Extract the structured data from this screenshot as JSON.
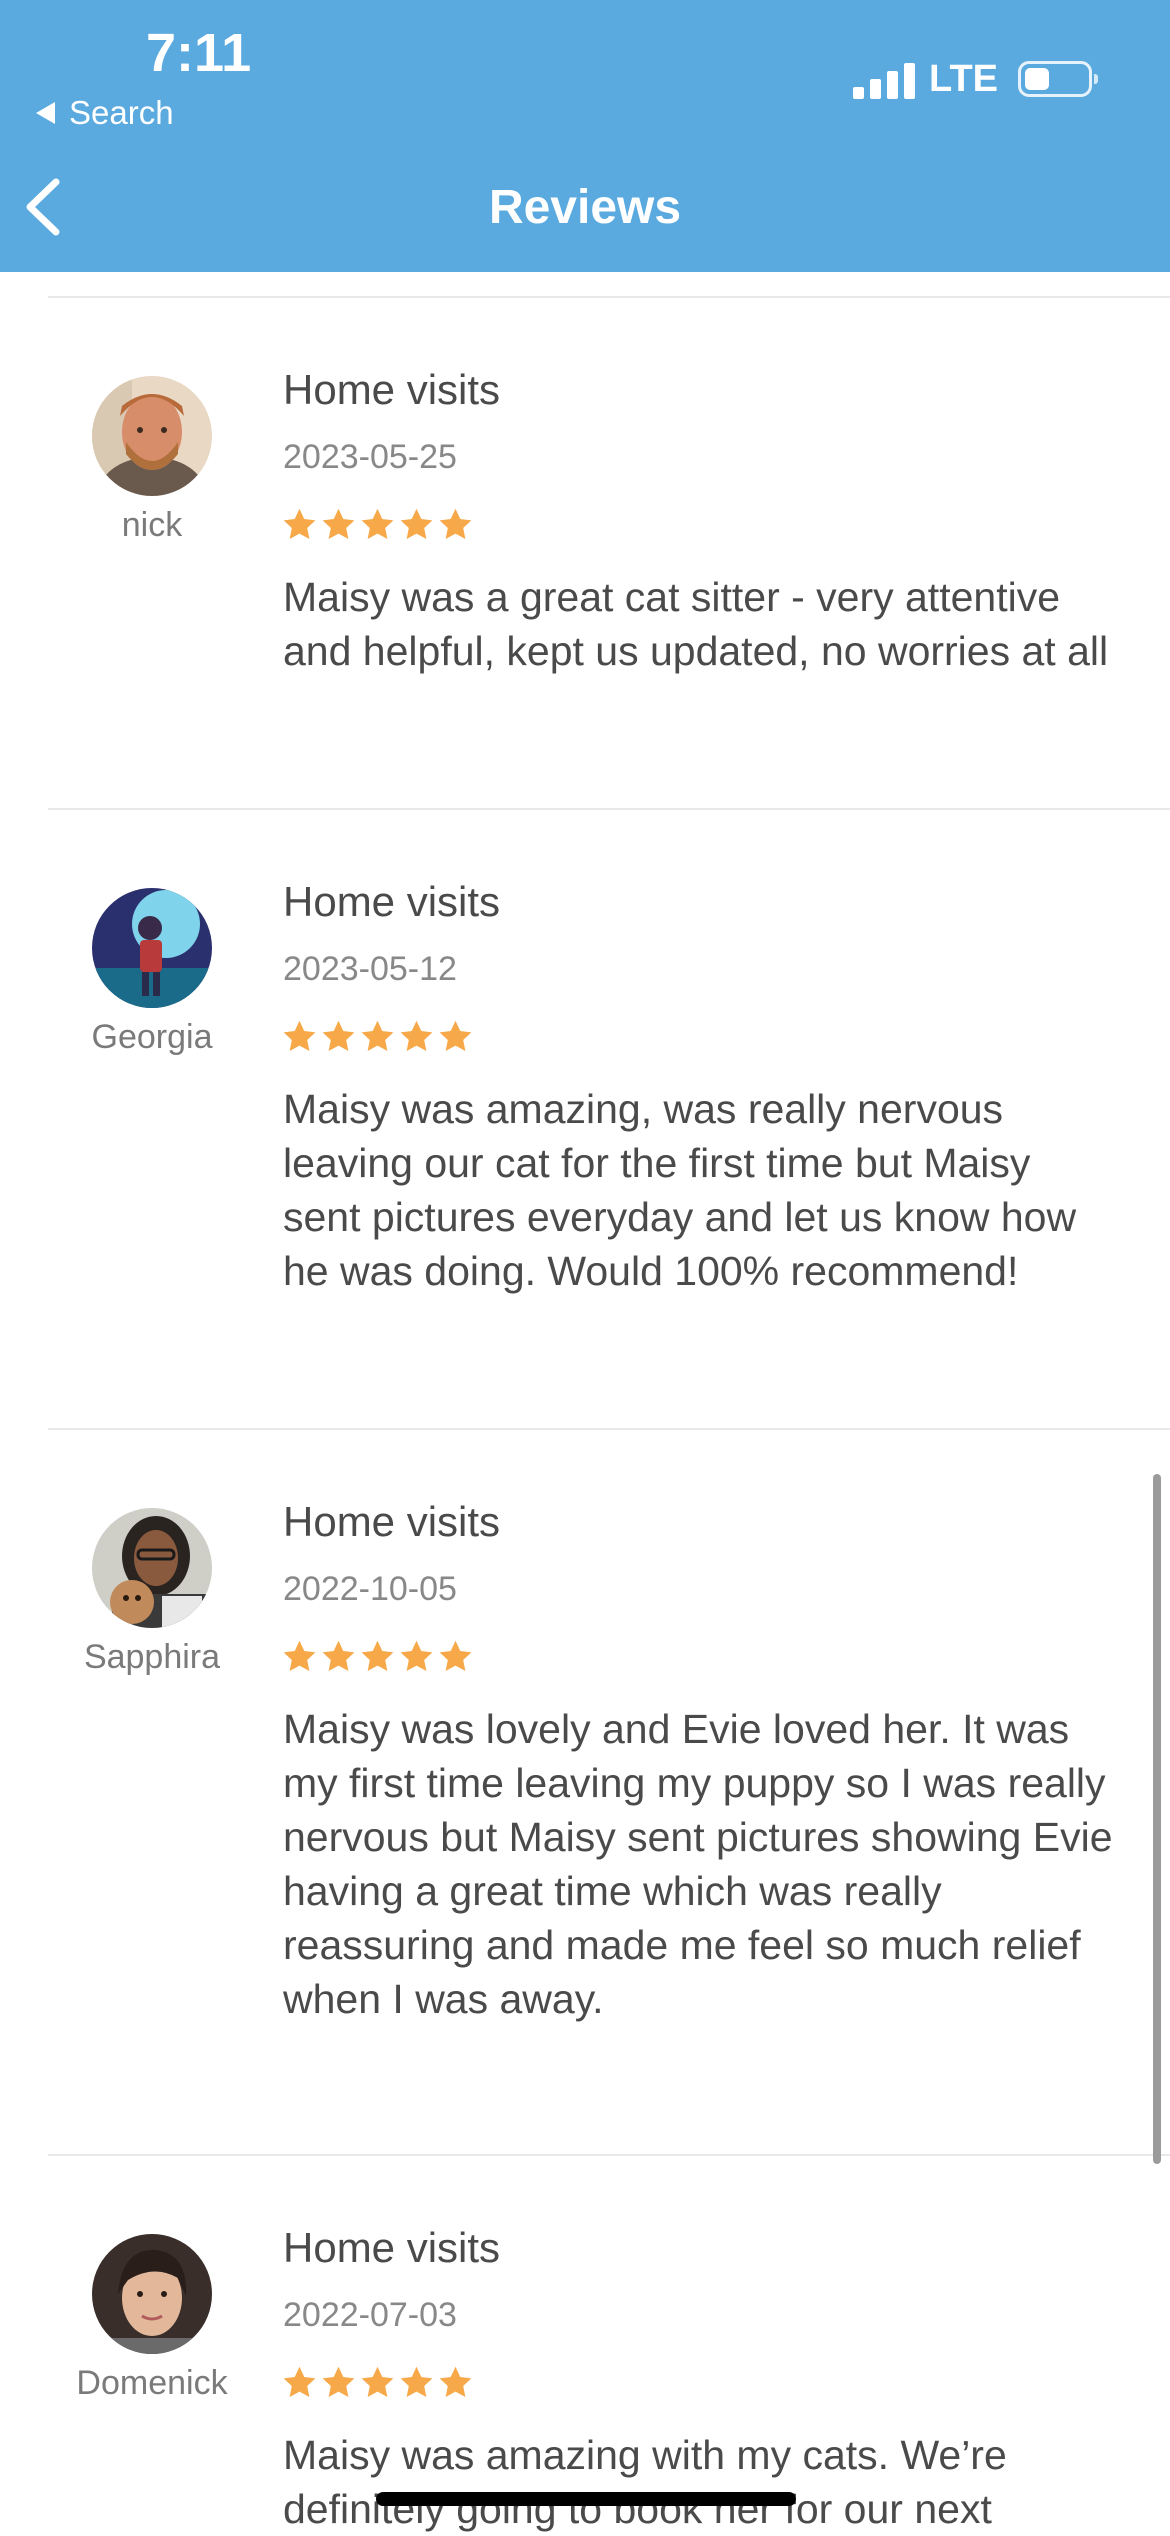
{
  "status_bar": {
    "time": "7:11",
    "back_app_label": "Search",
    "network": "LTE"
  },
  "header": {
    "title": "Reviews"
  },
  "colors": {
    "header_bg": "#5aaae0",
    "star": "#f7a94a"
  },
  "reviews": [
    {
      "name": "nick",
      "service": "Home visits",
      "date": "2023-05-25",
      "rating": 5,
      "text": "Maisy was a great cat sitter - very attentive and helpful, kept us updated, no worries at all"
    },
    {
      "name": "Georgia",
      "service": "Home visits",
      "date": "2023-05-12",
      "rating": 5,
      "text": "Maisy was amazing, was really nervous leaving our cat for the first time but Maisy sent pictures everyday and let us know how he was doing. Would 100% recommend!"
    },
    {
      "name": "Sapphira",
      "service": "Home visits",
      "date": "2022-10-05",
      "rating": 5,
      "text": "Maisy was lovely and Evie loved her. It was my first time leaving my puppy so I was really nervous but Maisy sent pictures showing Evie having a great time which was really reassuring and made me feel so much relief when I was away."
    },
    {
      "name": "Domenick",
      "service": "Home visits",
      "date": "2022-07-03",
      "rating": 5,
      "text": "Maisy was amazing with my cats. We’re definitely going to book her for our next"
    }
  ]
}
